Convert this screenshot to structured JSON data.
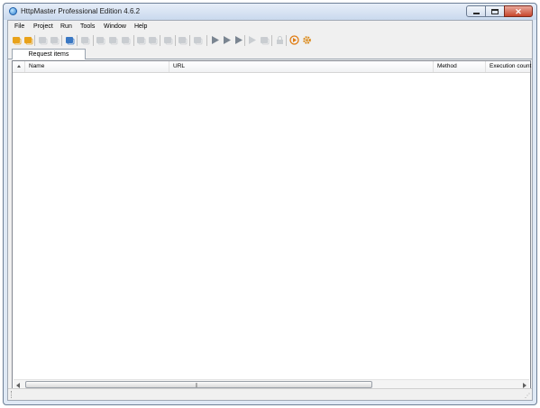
{
  "window": {
    "title": "HttpMaster Professional Edition 4.6.2"
  },
  "menu": {
    "items": [
      "File",
      "Project",
      "Run",
      "Tools",
      "Window",
      "Help"
    ]
  },
  "toolbar": {
    "buttons": [
      {
        "name": "new-project-icon",
        "color": "#e8a21b"
      },
      {
        "name": "open-project-icon",
        "color": "#e8a21b"
      },
      {
        "name": "save-project-icon",
        "color": "#9aa3ad"
      },
      {
        "name": "save-as-icon",
        "color": "#9aa3ad"
      },
      {
        "name": "add-request-icon",
        "color": "#3a78c4"
      },
      {
        "name": "remove-request-icon",
        "color": "#9aa3ad"
      },
      {
        "name": "import-icon",
        "color": "#9aa3ad"
      },
      {
        "name": "export-icon",
        "color": "#9aa3ad"
      },
      {
        "name": "copy-icon",
        "color": "#9aa3ad"
      },
      {
        "name": "paste-icon",
        "color": "#9aa3ad"
      },
      {
        "name": "clone-icon",
        "color": "#9aa3ad"
      },
      {
        "name": "edit-icon",
        "color": "#9aa3ad"
      },
      {
        "name": "step-icon",
        "color": "#9aa3ad"
      },
      {
        "name": "link-icon",
        "color": "#9aa3ad"
      },
      {
        "name": "run-icon",
        "color": "#7a8591"
      },
      {
        "name": "run-all-icon",
        "color": "#7a8591"
      },
      {
        "name": "run-selected-icon",
        "color": "#7a8591"
      },
      {
        "name": "run-group-icon",
        "color": "#9aa3ad"
      },
      {
        "name": "stop-icon",
        "color": "#9aa3ad"
      },
      {
        "name": "lock-icon",
        "color": "#9aa3ad"
      },
      {
        "name": "execute-icon",
        "color": "#e07b10"
      },
      {
        "name": "settings-icon",
        "color": "#d9840f"
      }
    ]
  },
  "tabs": [
    {
      "label": "Request items"
    }
  ],
  "columns": [
    "Name",
    "URL",
    "Method",
    "Execution count"
  ],
  "scroll": {
    "grip": "|||"
  },
  "status": {
    "grip": "⋰"
  }
}
